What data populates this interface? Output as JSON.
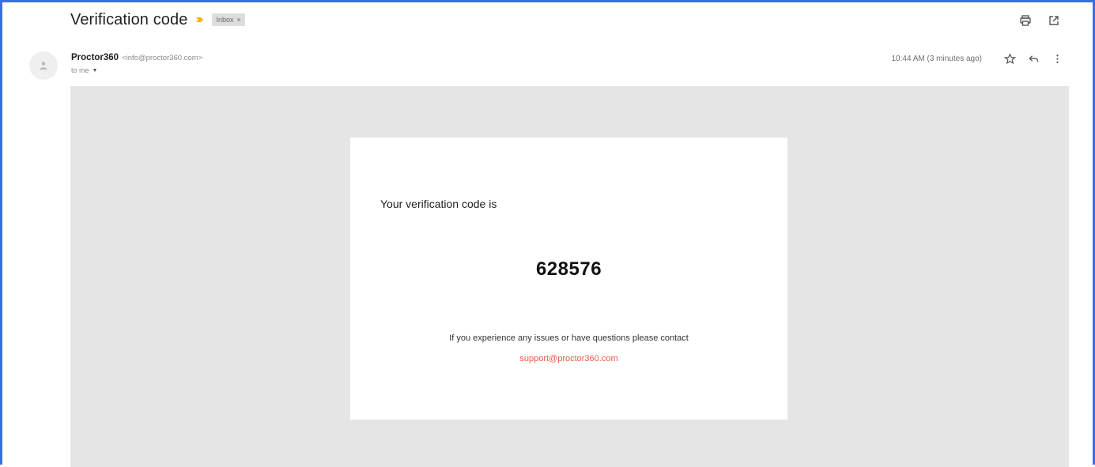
{
  "message": {
    "subject": "Verification code",
    "label": "Inbox",
    "label_close": "×"
  },
  "sender": {
    "name": "Proctor360",
    "email": "<info@proctor360.com>",
    "to": "to me",
    "to_caret": "▼",
    "timestamp": "10:44 AM (3 minutes ago)"
  },
  "body": {
    "intro": "Your verification code is",
    "code": "628576",
    "help": "If you experience any issues or have questions please contact",
    "support_email": "support@proctor360.com"
  },
  "icons": {
    "importance": "importance-marker-icon",
    "print": "print-icon",
    "new_window": "open-in-new-window-icon",
    "avatar": "default-avatar-icon",
    "star": "star-icon",
    "reply": "reply-icon",
    "more": "more-vertical-icon"
  },
  "colors": {
    "frame_border": "#3b6fe0",
    "importance": "#f4b400",
    "link": "#e8584a",
    "canvas": "#e5e5e5"
  }
}
